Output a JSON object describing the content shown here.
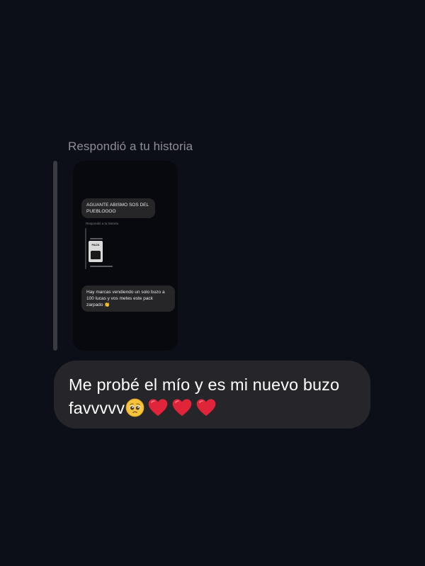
{
  "reply": {
    "caption": "Respondió a tu historia"
  },
  "story_preview": {
    "message_1": "AGUANTE ABISMO SOS DEL PUEBLOOOO",
    "caption": "Respondió a tu historia",
    "product_label": "PACK",
    "message_2": "Hay marcas vendiendo un solo buzo a 100 lucas y vos metes este pack zarpado 👏"
  },
  "message": {
    "text": "Me probé el mío y es mi nuevo buzo favvvvv",
    "emojis": [
      "pleading-face-icon",
      "red-heart-icon",
      "red-heart-icon",
      "red-heart-icon"
    ]
  },
  "colors": {
    "background": "#0c0f17",
    "bubble": "#26262a",
    "caption": "#8e8e93",
    "heart": "#e0243a"
  }
}
